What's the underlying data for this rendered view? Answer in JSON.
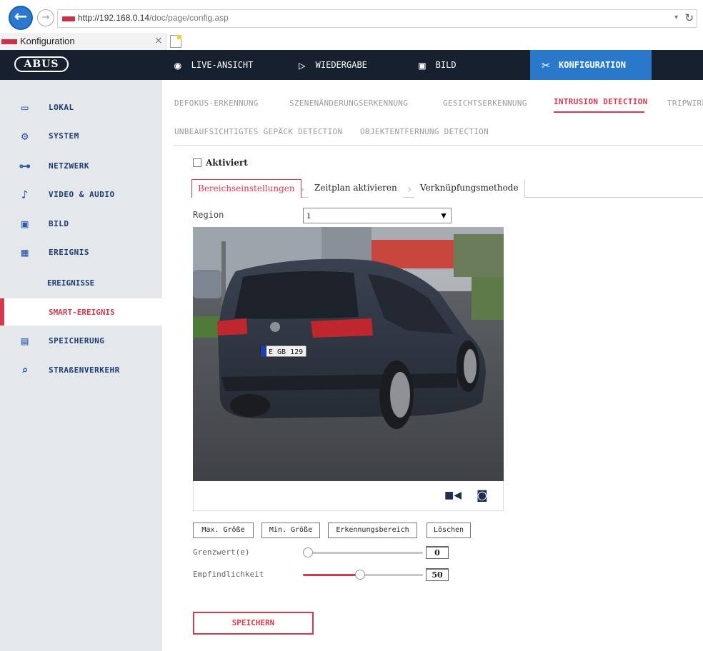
{
  "browser": {
    "url_host": "http://192.168.0.14",
    "url_path": "/doc/page/config.asp",
    "tab_title": "Konfiguration"
  },
  "header": {
    "logo": "ABUS",
    "nav": {
      "live": "LIVE-ANSICHT",
      "playback": "WIEDERGABE",
      "image": "BILD",
      "config": "KONFIGURATION"
    }
  },
  "sidebar": {
    "items": [
      {
        "label": "LOKAL",
        "icon": "monitor-icon"
      },
      {
        "label": "SYSTEM",
        "icon": "gear-icon"
      },
      {
        "label": "NETZWERK",
        "icon": "network-icon"
      },
      {
        "label": "VIDEO & AUDIO",
        "icon": "microphone-icon"
      },
      {
        "label": "BILD",
        "icon": "image-icon"
      },
      {
        "label": "EREIGNIS",
        "icon": "calendar-icon"
      },
      {
        "label": "SPEICHERUNG",
        "icon": "floppy-icon"
      },
      {
        "label": "STRAßENVERKEHR",
        "icon": "car-search-icon"
      }
    ],
    "sub": {
      "events": "EREIGNISSE",
      "smart": "SMART-EREIGNIS"
    }
  },
  "subtabs": {
    "defocus": "DEFOKUS-ERKENNUNG",
    "scene": "SZENENÄNDERUNGSERKENNUNG",
    "face": "GESICHTSERKENNUNG",
    "intrusion": "INTRUSION DETECTION",
    "tripwire": "TRIPWIRE",
    "unattended": "UNBEAUFSICHTIGTES GEPÄCK DETECTION",
    "removal": "OBJEKTENTFERNUNG DETECTION"
  },
  "enabled_label": "Aktiviert",
  "steps": {
    "area": "Bereichseinstellungen",
    "schedule": "Zeitplan aktivieren",
    "linkage": "Verknüpfungsmethode"
  },
  "region": {
    "label": "Region",
    "value": "1"
  },
  "plate_text": "E GB 129",
  "buttons": {
    "max": "Max. Größe",
    "min": "Min. Größe",
    "area": "Erkennungsbereich",
    "clear": "Löschen",
    "save": "SPEICHERN"
  },
  "threshold": {
    "label": "Grenzwert(e)",
    "value": "0",
    "level": 0
  },
  "sensitivity": {
    "label": "Empfindlichkeit",
    "value": "50",
    "level": 0.5
  },
  "colors": {
    "accent": "#d33a4e",
    "header_bg": "#16202f",
    "nav_active": "#2978c9",
    "sidebar_bg": "#e5e8eb"
  }
}
